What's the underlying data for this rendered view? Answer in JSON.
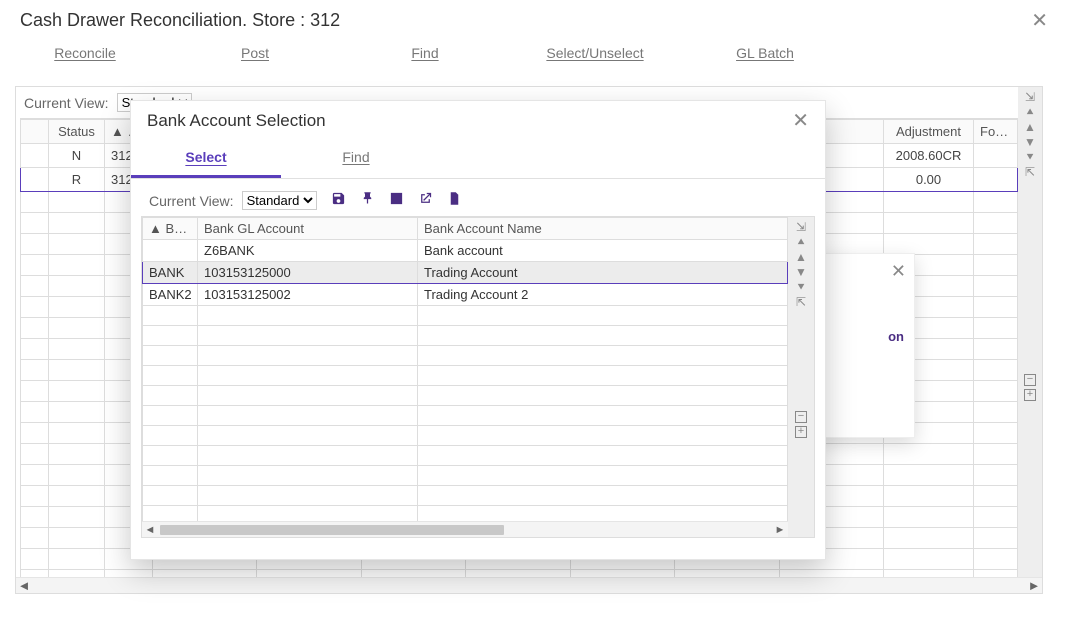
{
  "window": {
    "title": "Cash Drawer Reconciliation. Store : 312",
    "menu": {
      "reconcile": "Reconcile",
      "post": "Post",
      "find": "Find",
      "select_unselect": "Select/Unselect",
      "gl_batch": "GL Batch"
    }
  },
  "main": {
    "current_view_label": "Current View:",
    "current_view_value": "Standard",
    "columns": {
      "handle": "",
      "status": "Status",
      "sort2": "▲ S…",
      "adjustment": "Adjustment",
      "for": "For…"
    },
    "rows": [
      {
        "status": "N",
        "col2": "312",
        "adjustment": "2008.60CR",
        "for": ""
      },
      {
        "status": "R",
        "col2": "312",
        "adjustment": "0.00",
        "for": ""
      }
    ]
  },
  "info_card": {
    "label_suffix": "on"
  },
  "modal": {
    "title": "Bank Account Selection",
    "tabs": {
      "select": "Select",
      "find": "Find"
    },
    "current_view_label": "Current View:",
    "current_view_value": "Standard",
    "columns": {
      "code": "▲ B…",
      "gl": "Bank GL Account",
      "name": "Bank Account Name"
    },
    "rows": [
      {
        "code": "",
        "gl": "Z6BANK",
        "name": "Bank account"
      },
      {
        "code": "BANK",
        "gl": "103153125000",
        "name": "Trading Account"
      },
      {
        "code": "BANK2",
        "gl": "103153125002",
        "name": "Trading Account 2"
      }
    ],
    "selected_index": 1
  },
  "icons": {
    "save": "save-icon",
    "pin": "pin-icon",
    "window": "window-icon",
    "popout": "popout-icon",
    "file": "file-icon"
  }
}
